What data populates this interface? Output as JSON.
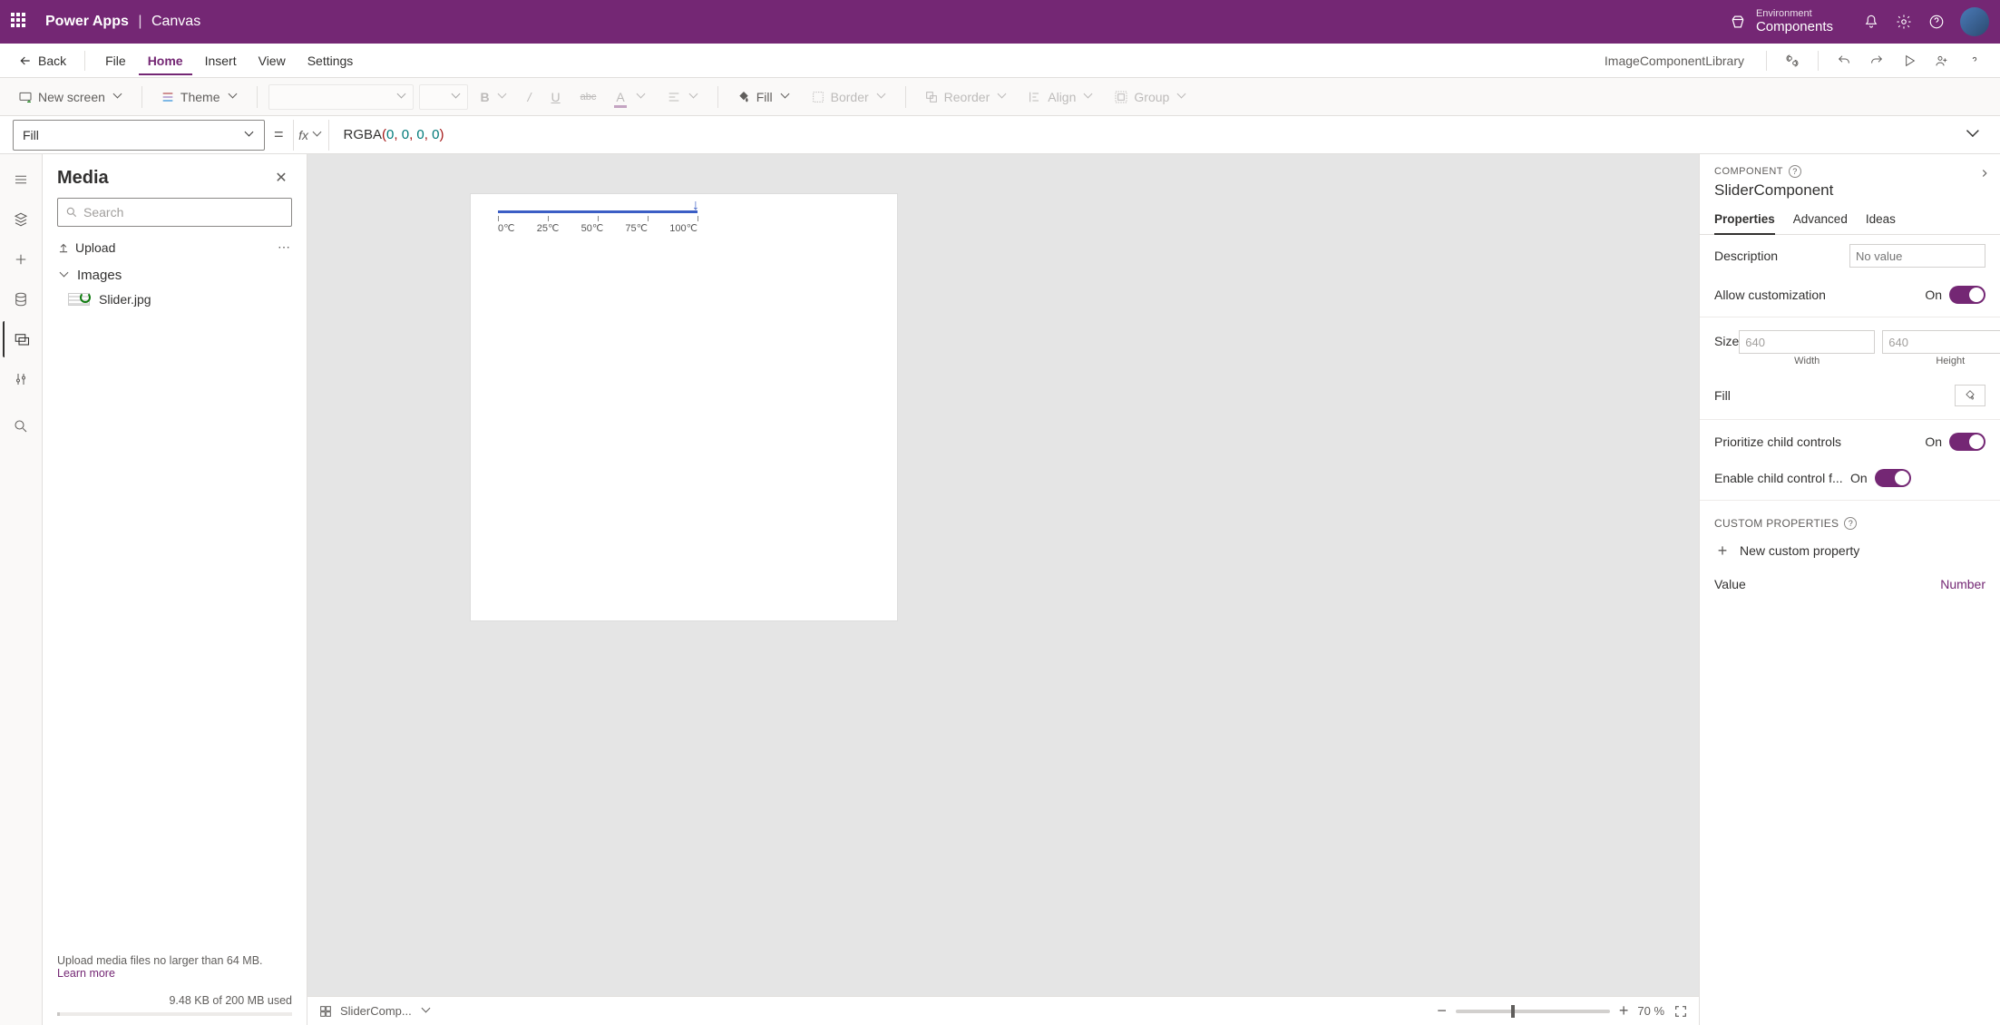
{
  "titlebar": {
    "app_name": "Power Apps",
    "separator": "|",
    "context": "Canvas",
    "env_label": "Environment",
    "env_name": "Components"
  },
  "menubar": {
    "back": "Back",
    "items": [
      "File",
      "Home",
      "Insert",
      "View",
      "Settings"
    ],
    "active_index": 1,
    "document": "ImageComponentLibrary"
  },
  "ribbon": {
    "new_screen": "New screen",
    "theme": "Theme",
    "fill": "Fill",
    "border": "Border",
    "reorder": "Reorder",
    "align": "Align",
    "group": "Group"
  },
  "formulabar": {
    "property": "Fill",
    "formula_fn": "RGBA",
    "formula_args": [
      "0",
      "0",
      "0",
      "0"
    ]
  },
  "media": {
    "title": "Media",
    "search_placeholder": "Search",
    "upload": "Upload",
    "group": "Images",
    "item": "Slider.jpg",
    "footer_note": "Upload media files no larger than 64 MB.",
    "learn_more": "Learn more",
    "usage": "9.48 KB of 200 MB used"
  },
  "canvas": {
    "slider_labels": [
      "0℃",
      "25℃",
      "50℃",
      "75℃",
      "100℃"
    ],
    "breadcrumb": "SliderComp...",
    "zoom_value": "70",
    "zoom_unit": "%"
  },
  "props": {
    "section": "COMPONENT",
    "name": "SliderComponent",
    "tabs": [
      "Properties",
      "Advanced",
      "Ideas"
    ],
    "description_label": "Description",
    "description_placeholder": "No value",
    "allow_custom_label": "Allow customization",
    "on_text": "On",
    "size_label": "Size",
    "width_value": "640",
    "height_value": "640",
    "width_label": "Width",
    "height_label": "Height",
    "fill_label": "Fill",
    "prioritize_label": "Prioritize child controls",
    "enable_child_label": "Enable child control f...",
    "custom_head": "CUSTOM PROPERTIES",
    "new_custom": "New custom property",
    "value_label": "Value",
    "value_type": "Number"
  }
}
